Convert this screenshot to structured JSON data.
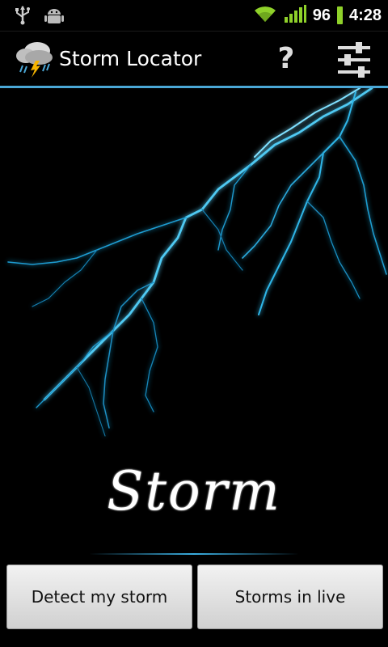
{
  "status_bar": {
    "icons_left": [
      "usb-icon",
      "android-debug-icon"
    ],
    "icons_right": [
      "wifi-icon",
      "signal-icon"
    ],
    "battery_level": "96",
    "time": "4:28",
    "battery_color": "#8fd12a"
  },
  "action_bar": {
    "app_icon": "storm-cloud-icon",
    "title": "Storm Locator",
    "help_label": "?",
    "settings_icon": "sliders-icon",
    "divider_color": "#4aa7d6"
  },
  "hero": {
    "image": "lightning-bolt-image",
    "logo_text": "Storm",
    "accent_color": "#3aaee0"
  },
  "buttons": {
    "detect_label": "Detect my storm",
    "live_label": "Storms in live"
  }
}
